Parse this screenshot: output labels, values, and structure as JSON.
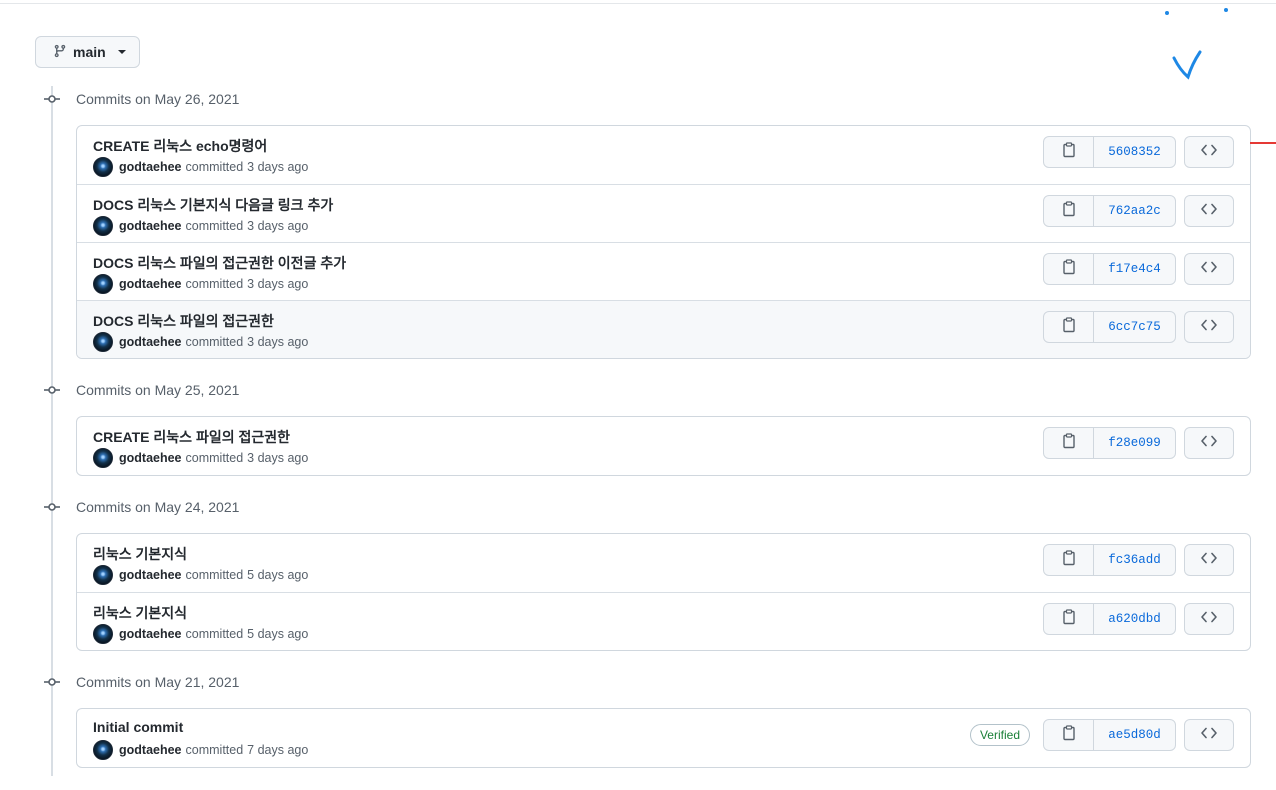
{
  "branch": {
    "name": "main"
  },
  "groups": [
    {
      "title": "Commits on May 26, 2021",
      "commits": [
        {
          "message": "CREATE 리눅스 echo명령어",
          "author": "godtaehee",
          "verb": "committed",
          "time": "3 days ago",
          "sha": "5608352"
        },
        {
          "message": "DOCS 리눅스 기본지식 다음글 링크 추가",
          "author": "godtaehee",
          "verb": "committed",
          "time": "3 days ago",
          "sha": "762aa2c"
        },
        {
          "message": "DOCS 리눅스 파일의 접근권한 이전글 추가",
          "author": "godtaehee",
          "verb": "committed",
          "time": "3 days ago",
          "sha": "f17e4c4"
        },
        {
          "message": "DOCS 리눅스 파일의 접근권한",
          "author": "godtaehee",
          "verb": "committed",
          "time": "3 days ago",
          "sha": "6cc7c75"
        }
      ]
    },
    {
      "title": "Commits on May 25, 2021",
      "commits": [
        {
          "message": "CREATE 리눅스 파일의 접근권한",
          "author": "godtaehee",
          "verb": "committed",
          "time": "3 days ago",
          "sha": "f28e099"
        }
      ]
    },
    {
      "title": "Commits on May 24, 2021",
      "commits": [
        {
          "message": "리눅스 기본지식",
          "author": "godtaehee",
          "verb": "committed",
          "time": "5 days ago",
          "sha": "fc36add"
        },
        {
          "message": "리눅스 기본지식",
          "author": "godtaehee",
          "verb": "committed",
          "time": "5 days ago",
          "sha": "a620dbd"
        }
      ]
    },
    {
      "title": "Commits on May 21, 2021",
      "commits": [
        {
          "message": "Initial commit",
          "author": "godtaehee",
          "verb": "committed",
          "time": "7 days ago",
          "sha": "ae5d80d",
          "badge": "Verified"
        }
      ]
    }
  ],
  "icons": {
    "branch": "git-branch-icon",
    "caret": "caret-down-icon",
    "timeline": "git-commit-icon",
    "copy": "clipboard-icon",
    "browse": "code-icon"
  },
  "colors": {
    "link": "#0969da",
    "verified": "#1a7f37",
    "muted": "#57606a",
    "annotation_blue": "#1e88e5",
    "annotation_red": "#e53935"
  }
}
